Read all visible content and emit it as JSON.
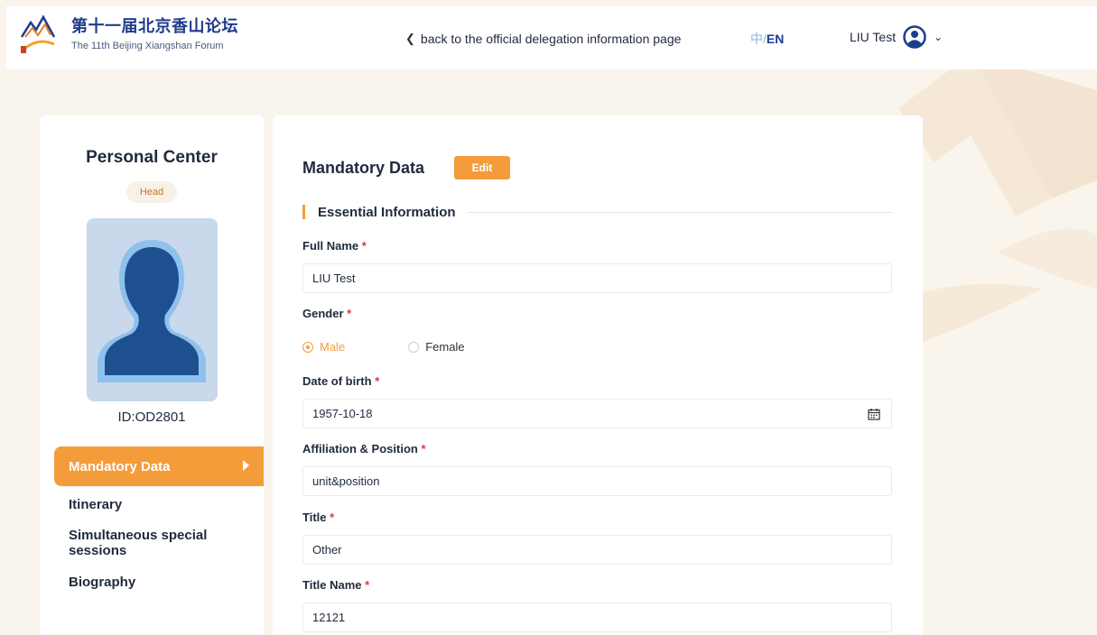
{
  "header": {
    "brand_cn": "第十一届北京香山论坛",
    "brand_en": "The 11th Beijing Xiangshan Forum",
    "back_link": "back to the official delegation information page",
    "lang_zh": "中",
    "lang_sep": "/",
    "lang_en": "EN",
    "user_name": "LIU Test"
  },
  "sidebar": {
    "title": "Personal Center",
    "badge": "Head",
    "user_id": "ID:OD2801",
    "items": [
      {
        "label": "Mandatory Data",
        "active": true
      },
      {
        "label": "Itinerary"
      },
      {
        "label": "Simultaneous special sessions"
      },
      {
        "label": "Biography"
      }
    ]
  },
  "main": {
    "title": "Mandatory Data",
    "edit_label": "Edit",
    "section_title": "Essential Information",
    "required_mark": "*",
    "fields": {
      "full_name": {
        "label": "Full Name",
        "value": "LIU Test"
      },
      "gender": {
        "label": "Gender",
        "options": [
          "Male",
          "Female"
        ],
        "selected": "Male"
      },
      "dob": {
        "label": "Date of birth",
        "value": "1957-10-18"
      },
      "affiliation": {
        "label": "Affiliation & Position",
        "value": "unit&position"
      },
      "title": {
        "label": "Title",
        "value": "Other"
      },
      "title_name": {
        "label": "Title Name",
        "value": "12121"
      }
    }
  },
  "colors": {
    "accent": "#f49c3a",
    "brand_blue": "#1f3b8a",
    "background": "#faf5ec",
    "required": "#e0393e"
  },
  "icons": [
    "logo-mountains",
    "back-chevron-icon",
    "user-circle-icon",
    "chevron-down-icon",
    "calendar-icon",
    "caret-right-icon"
  ]
}
